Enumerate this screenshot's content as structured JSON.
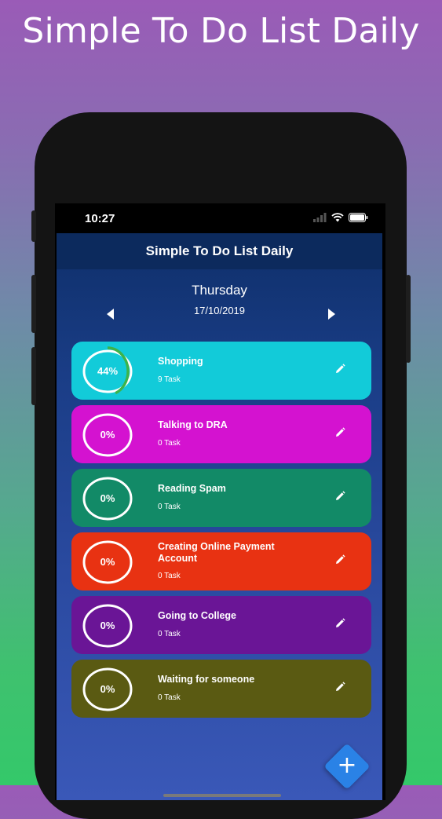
{
  "promo": {
    "title": "Simple To Do List Daily"
  },
  "status_bar": {
    "time": "10:27",
    "icons": [
      "signal-icon",
      "wifi-icon",
      "battery-icon"
    ]
  },
  "app": {
    "header_title": "Simple To Do List Daily",
    "day": "Thursday",
    "date": "17/10/2019",
    "prev_icon": "previous-day-icon",
    "next_icon": "next-day-icon"
  },
  "lists": [
    {
      "title": "Shopping",
      "subtitle": "9 Task",
      "progress_label": "44%",
      "progress": 0.44,
      "color": "#12cbd9"
    },
    {
      "title": "Talking to DRA",
      "subtitle": "0 Task",
      "progress_label": "0%",
      "progress": 0,
      "color": "#d412d0"
    },
    {
      "title": "Reading Spam",
      "subtitle": "0 Task",
      "progress_label": "0%",
      "progress": 0,
      "color": "#128a67"
    },
    {
      "title": "Creating Online Payment Account",
      "subtitle": "0 Task",
      "progress_label": "0%",
      "progress": 0,
      "color": "#e83212"
    },
    {
      "title": "Going to  College",
      "subtitle": "0 Task",
      "progress_label": "0%",
      "progress": 0,
      "color": "#6a1596"
    },
    {
      "title": "Waiting for someone",
      "subtitle": "0 Task",
      "progress_label": "0%",
      "progress": 0,
      "color": "#5a5a12"
    }
  ],
  "fab": {
    "label": "+",
    "icon": "add-icon",
    "color": "#2a82e6"
  },
  "colors": {
    "ring_track": "#ffffff",
    "ring_progress": "#3db34a"
  }
}
